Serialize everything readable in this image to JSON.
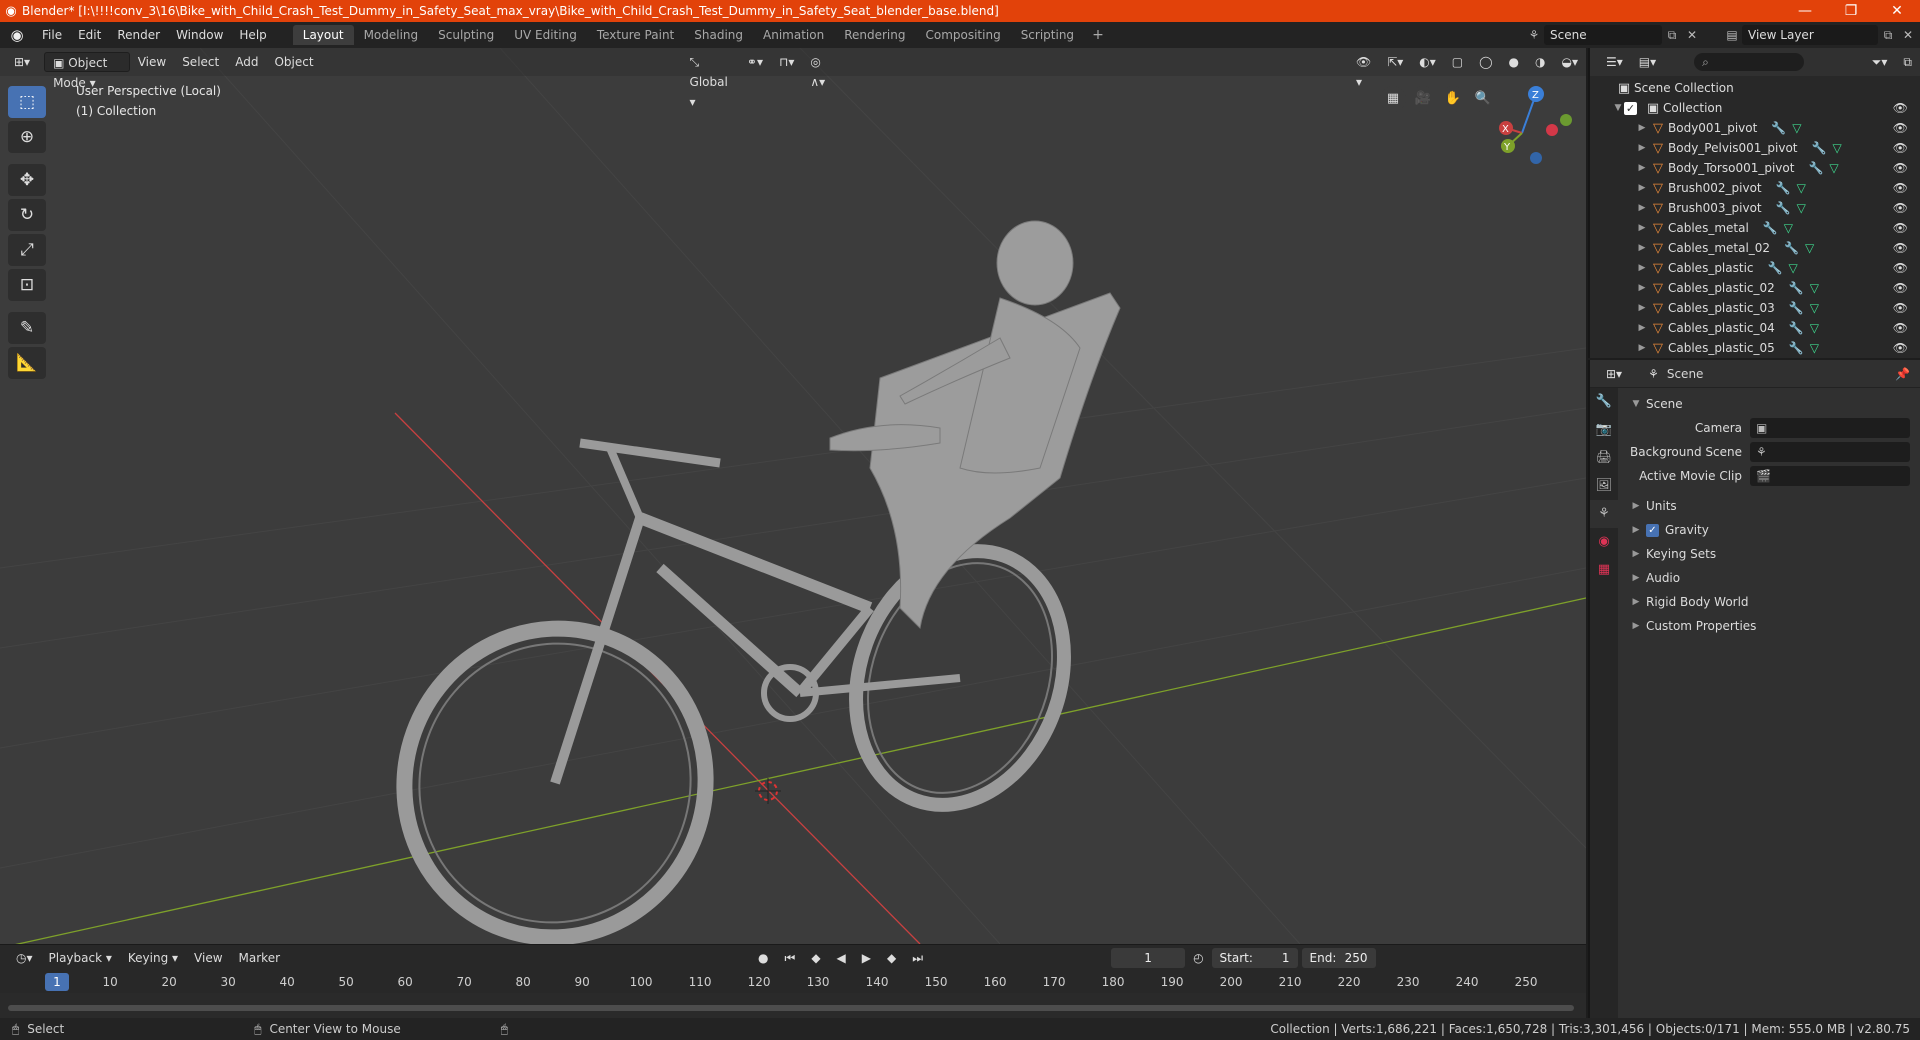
{
  "window": {
    "title": "Blender* [I:\\!!!!conv_3\\16\\Bike_with_Child_Crash_Test_Dummy_in_Safety_Seat_max_vray\\Bike_with_Child_Crash_Test_Dummy_in_Safety_Seat_blender_base.blend]",
    "minimize": "—",
    "maximize": "❐",
    "close": "✕"
  },
  "menu": [
    "File",
    "Edit",
    "Render",
    "Window",
    "Help"
  ],
  "workspaces": [
    "Layout",
    "Modeling",
    "Sculpting",
    "UV Editing",
    "Texture Paint",
    "Shading",
    "Animation",
    "Rendering",
    "Compositing",
    "Scripting"
  ],
  "active_workspace": "Layout",
  "scene_name": "Scene",
  "view_layer_name": "View Layer",
  "viewport": {
    "mode": "Object Mode",
    "menus": [
      "View",
      "Select",
      "Add",
      "Object"
    ],
    "orientation": "Global",
    "info_line1": "User Perspective (Local)",
    "info_line2": "(1) Collection",
    "gizmo": {
      "x": "X",
      "y": "Y",
      "z": "Z"
    }
  },
  "timeline": {
    "menus": [
      "Playback",
      "Keying",
      "View",
      "Marker"
    ],
    "current_frame": "1",
    "start_label": "Start:",
    "start": "1",
    "end_label": "End:",
    "end": "250",
    "ticks": [
      "1",
      "10",
      "20",
      "30",
      "40",
      "50",
      "60",
      "70",
      "80",
      "90",
      "100",
      "110",
      "120",
      "130",
      "140",
      "150",
      "160",
      "170",
      "180",
      "190",
      "200",
      "210",
      "220",
      "230",
      "240",
      "250"
    ]
  },
  "statusbar": {
    "select": "Select",
    "center_view": "Center View to Mouse",
    "stats": "Collection | Verts:1,686,221 | Faces:1,650,728 | Tris:3,301,456 | Objects:0/171 | Mem: 555.0 MB | v2.80.75"
  },
  "outliner": {
    "root": "Scene Collection",
    "collection": "Collection",
    "items": [
      "Body001_pivot",
      "Body_Pelvis001_pivot",
      "Body_Torso001_pivot",
      "Brush002_pivot",
      "Brush003_pivot",
      "Cables_metal",
      "Cables_metal_02",
      "Cables_plastic",
      "Cables_plastic_02",
      "Cables_plastic_03",
      "Cables_plastic_04",
      "Cables_plastic_05"
    ]
  },
  "properties": {
    "context": "Scene",
    "panel_title": "Scene",
    "camera_label": "Camera",
    "background_scene_label": "Background Scene",
    "movie_clip_label": "Active Movie Clip",
    "subpanels": [
      "Units",
      "Gravity",
      "Keying Sets",
      "Audio",
      "Rigid Body World",
      "Custom Properties"
    ]
  },
  "colors": {
    "accent": "#4772b3",
    "titlebar": "#e2420a",
    "x_axis": "#c84040",
    "y_axis": "#7ea12a",
    "z_axis": "#3a7fd8"
  }
}
